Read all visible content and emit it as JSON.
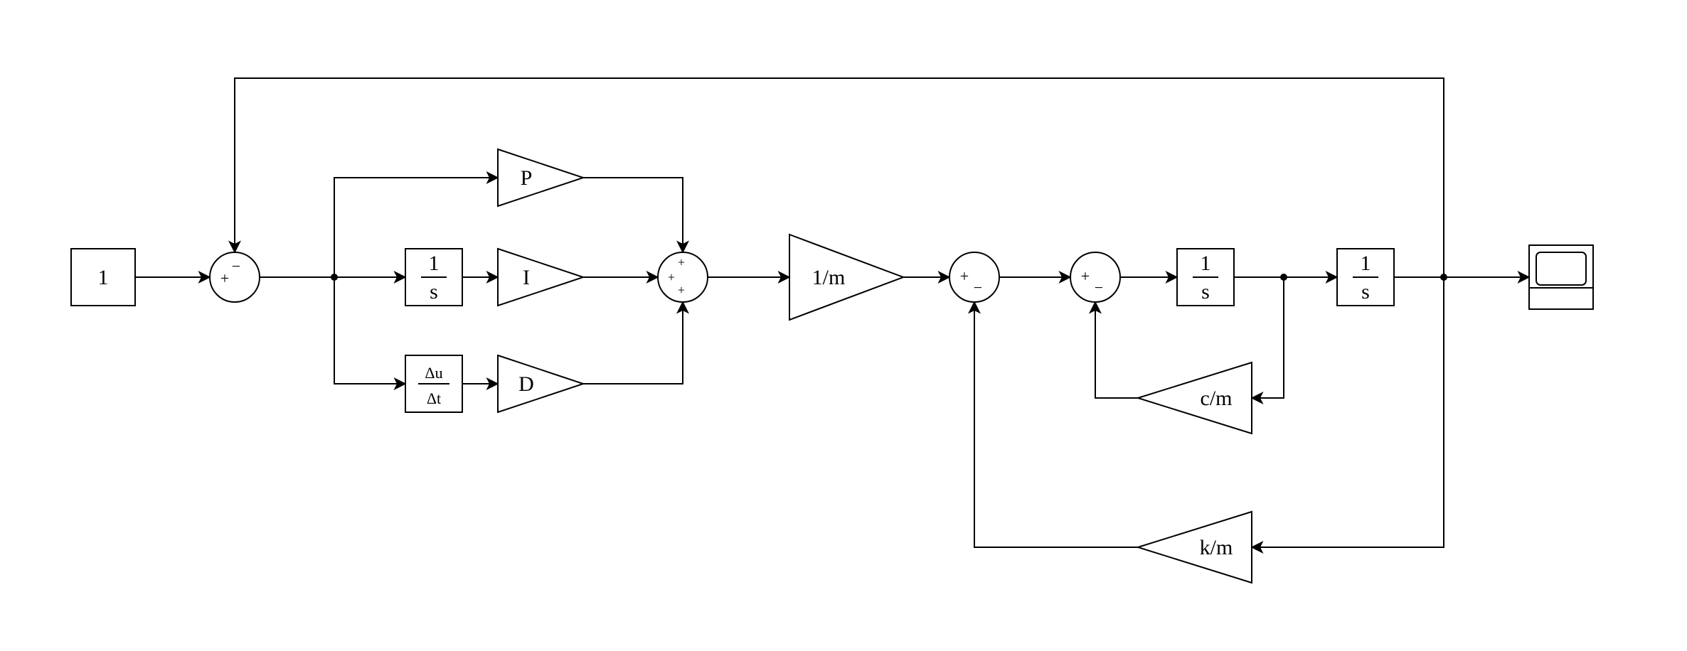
{
  "blocks": {
    "constant": {
      "label": "1"
    },
    "p_gain": {
      "label": "P"
    },
    "i_gain": {
      "label": "I"
    },
    "d_gain": {
      "label": "D"
    },
    "integrator1": {
      "num": "1",
      "den": "s"
    },
    "derivative": {
      "num": "Δu",
      "den": "Δt"
    },
    "inv_mass": {
      "label": "1/m"
    },
    "integrator2": {
      "num": "1",
      "den": "s"
    },
    "integrator3": {
      "num": "1",
      "den": "s"
    },
    "c_over_m": {
      "label": "c/m"
    },
    "k_over_m": {
      "label": "k/m"
    }
  },
  "sum": {
    "sum1": {
      "top": "−",
      "left": "+"
    },
    "sumPID": {
      "top": "+",
      "left": "+",
      "bottom": "+"
    },
    "sum2": {
      "left": "+",
      "bottom": "−"
    },
    "sum3": {
      "left": "+",
      "bottom": "−"
    }
  }
}
